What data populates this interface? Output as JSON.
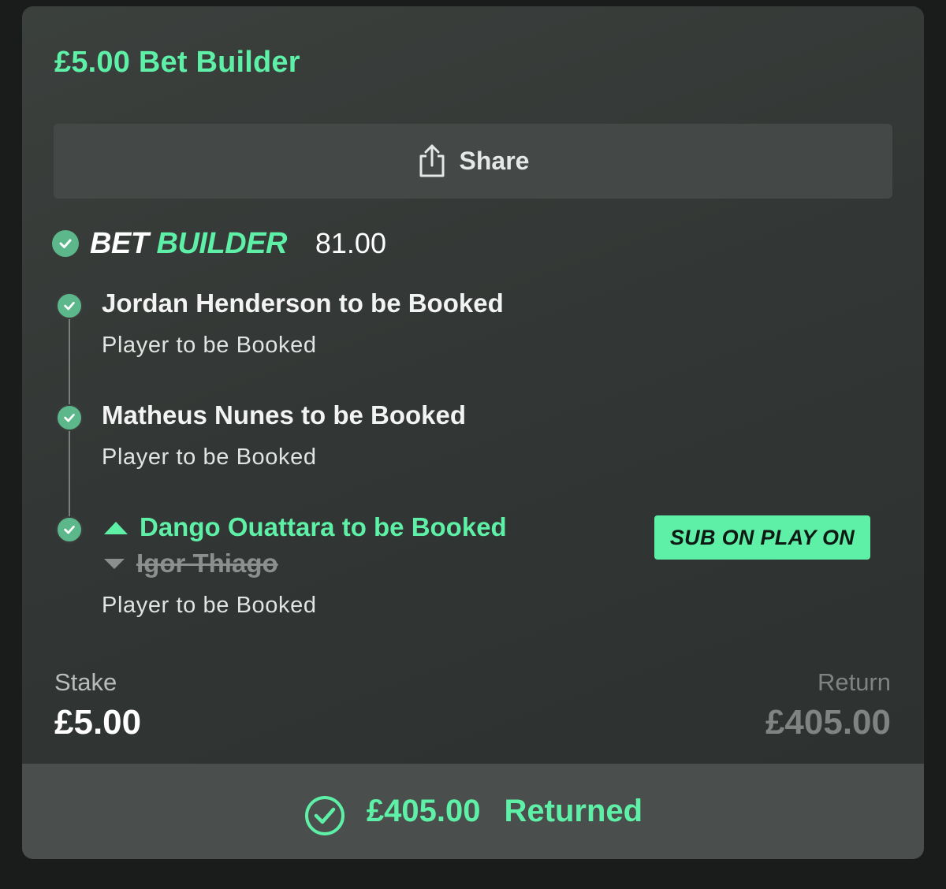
{
  "header": {
    "title": "£5.00 Bet Builder"
  },
  "share": {
    "label": "Share",
    "icon": "share-icon"
  },
  "bet_builder": {
    "label_bet": "BET",
    "label_builder": "BUILDER",
    "odds": "81.00",
    "legs": [
      {
        "title": "Jordan Henderson to be Booked",
        "market": "Player to be Booked",
        "status": "won"
      },
      {
        "title": "Matheus Nunes to be Booked",
        "market": "Player to be Booked",
        "status": "won"
      },
      {
        "title": "Dango Ouattara to be Booked",
        "replaced": "Igor Thiago",
        "market": "Player to be Booked",
        "status": "won",
        "badge": "SUB ON PLAY ON"
      }
    ]
  },
  "stake": {
    "label": "Stake",
    "value": "£5.00"
  },
  "return": {
    "label": "Return",
    "value": "£405.00"
  },
  "result": {
    "amount": "£405.00",
    "text": "Returned"
  },
  "colors": {
    "accent": "#5ef0a6",
    "check": "#5cb88a",
    "card": "#363a38"
  }
}
